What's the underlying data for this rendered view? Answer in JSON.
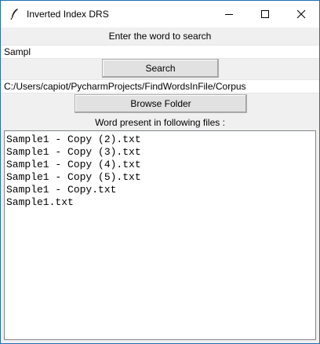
{
  "window": {
    "title": "Inverted Index DRS"
  },
  "search": {
    "prompt_label": "Enter the word to search",
    "query_value": "Sampl",
    "button_label": "Search"
  },
  "folder": {
    "path_value": "C:/Users/capiot/PycharmProjects/FindWordsInFile/Corpus",
    "browse_label": "Browse Folder"
  },
  "results": {
    "header_label": "Word present in following files :",
    "files": [
      "Sample1 - Copy (2).txt",
      "Sample1 - Copy (3).txt",
      "Sample1 - Copy (4).txt",
      "Sample1 - Copy (5).txt",
      "Sample1 - Copy.txt",
      "Sample1.txt"
    ]
  },
  "colors": {
    "window_border": "#1f70b4",
    "background": "#f0f0f0",
    "button_face": "#e1e1e1"
  }
}
